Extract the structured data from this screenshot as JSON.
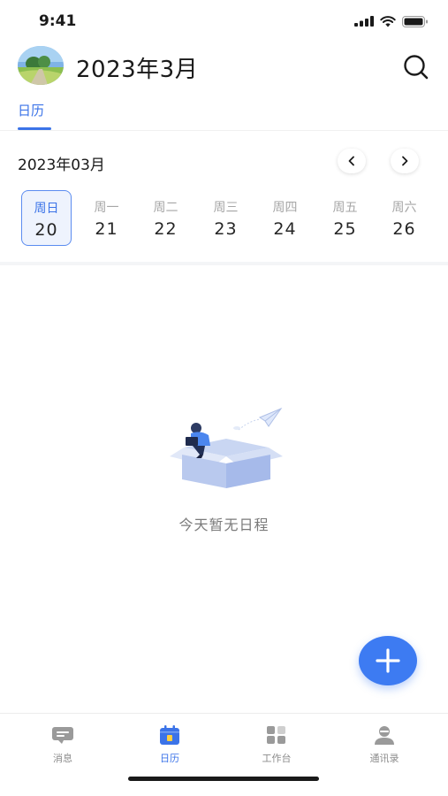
{
  "status_bar": {
    "time": "9:41"
  },
  "header": {
    "title": "2023年3月"
  },
  "tabs": [
    {
      "label": "日历",
      "active": true
    }
  ],
  "calendar": {
    "month_label": "2023年03月",
    "days": [
      {
        "weekday": "周日",
        "date": "20",
        "selected": true
      },
      {
        "weekday": "周一",
        "date": "21"
      },
      {
        "weekday": "周二",
        "date": "22"
      },
      {
        "weekday": "周三",
        "date": "23"
      },
      {
        "weekday": "周四",
        "date": "24"
      },
      {
        "weekday": "周五",
        "date": "25"
      },
      {
        "weekday": "周六",
        "date": "26"
      }
    ]
  },
  "empty_state": {
    "text": "今天暂无日程"
  },
  "bottom_nav": [
    {
      "label": "消息",
      "icon": "message-icon"
    },
    {
      "label": "日历",
      "icon": "calendar-icon",
      "active": true
    },
    {
      "label": "工作台",
      "icon": "workbench-icon"
    },
    {
      "label": "通讯录",
      "icon": "contacts-icon"
    }
  ],
  "colors": {
    "accent": "#3b73e8",
    "fab": "#3d7bf2",
    "muted": "#a6a6a6"
  }
}
